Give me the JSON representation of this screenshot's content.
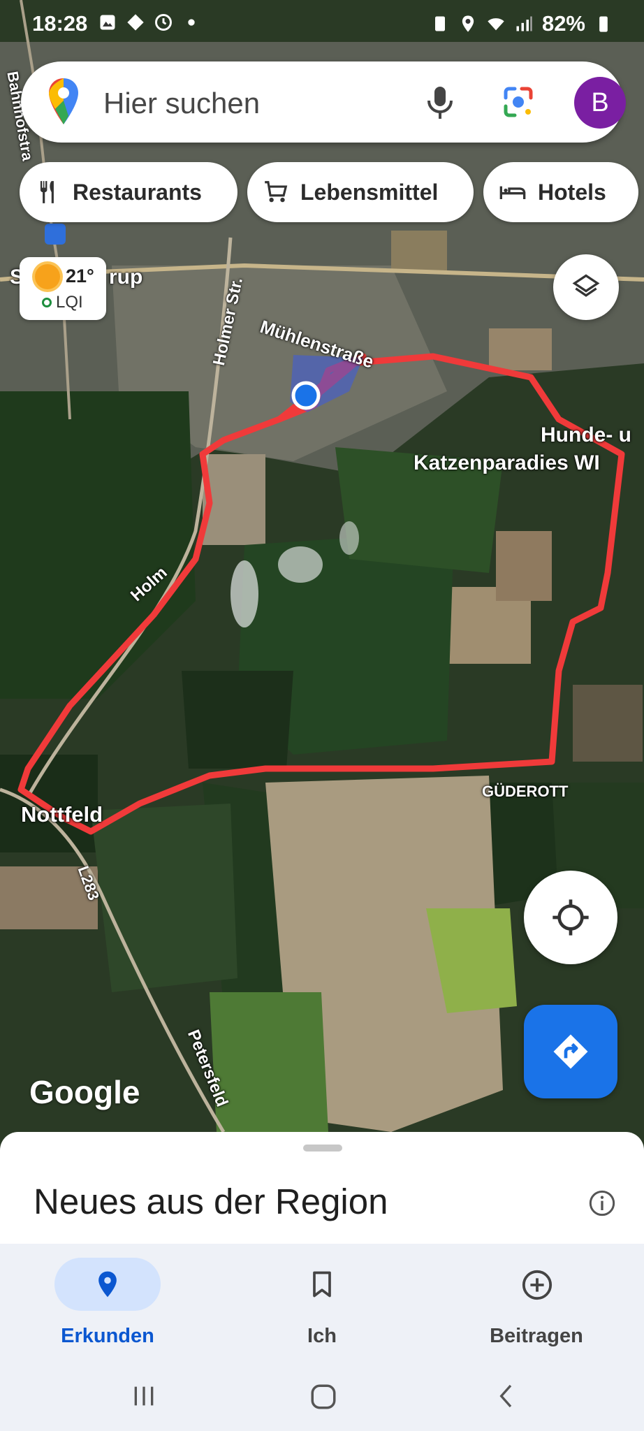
{
  "status_bar": {
    "time": "18:28",
    "battery": "82%"
  },
  "search": {
    "placeholder": "Hier suchen",
    "avatar_letter": "B"
  },
  "chips": [
    {
      "label": "Restaurants",
      "icon": "fork-knife-icon"
    },
    {
      "label": "Lebensmittel",
      "icon": "cart-icon"
    },
    {
      "label": "Hotels",
      "icon": "bed-icon"
    }
  ],
  "weather": {
    "temp": "21°",
    "aqi": "LQI"
  },
  "map_labels": {
    "town_fragment_left": "S",
    "town_fragment_right": "rup",
    "bahnhofstr": "Bahnhofstra",
    "holmer_str": "Holmer Str.",
    "muehlenstrasse": "Mühlenstraße",
    "poi_line1": "Hunde- u",
    "poi_line2": "Katzenparadies WI",
    "holm": "Holm",
    "gueterott": "GÜDEROTT",
    "nottfeld": "Nottfeld",
    "l283": "L283",
    "petersfeld": "Petersfeld",
    "google": "Google"
  },
  "sheet": {
    "title": "Neues aus der Region"
  },
  "nav": [
    {
      "label": "Erkunden",
      "icon": "explore-pin-icon",
      "active": true
    },
    {
      "label": "Ich",
      "icon": "bookmark-icon",
      "active": false
    },
    {
      "label": "Beitragen",
      "icon": "add-circle-icon",
      "active": false
    }
  ],
  "colors": {
    "route": "#f03a3a",
    "accent_blue": "#1a73e8",
    "avatar": "#7a1fa2"
  }
}
